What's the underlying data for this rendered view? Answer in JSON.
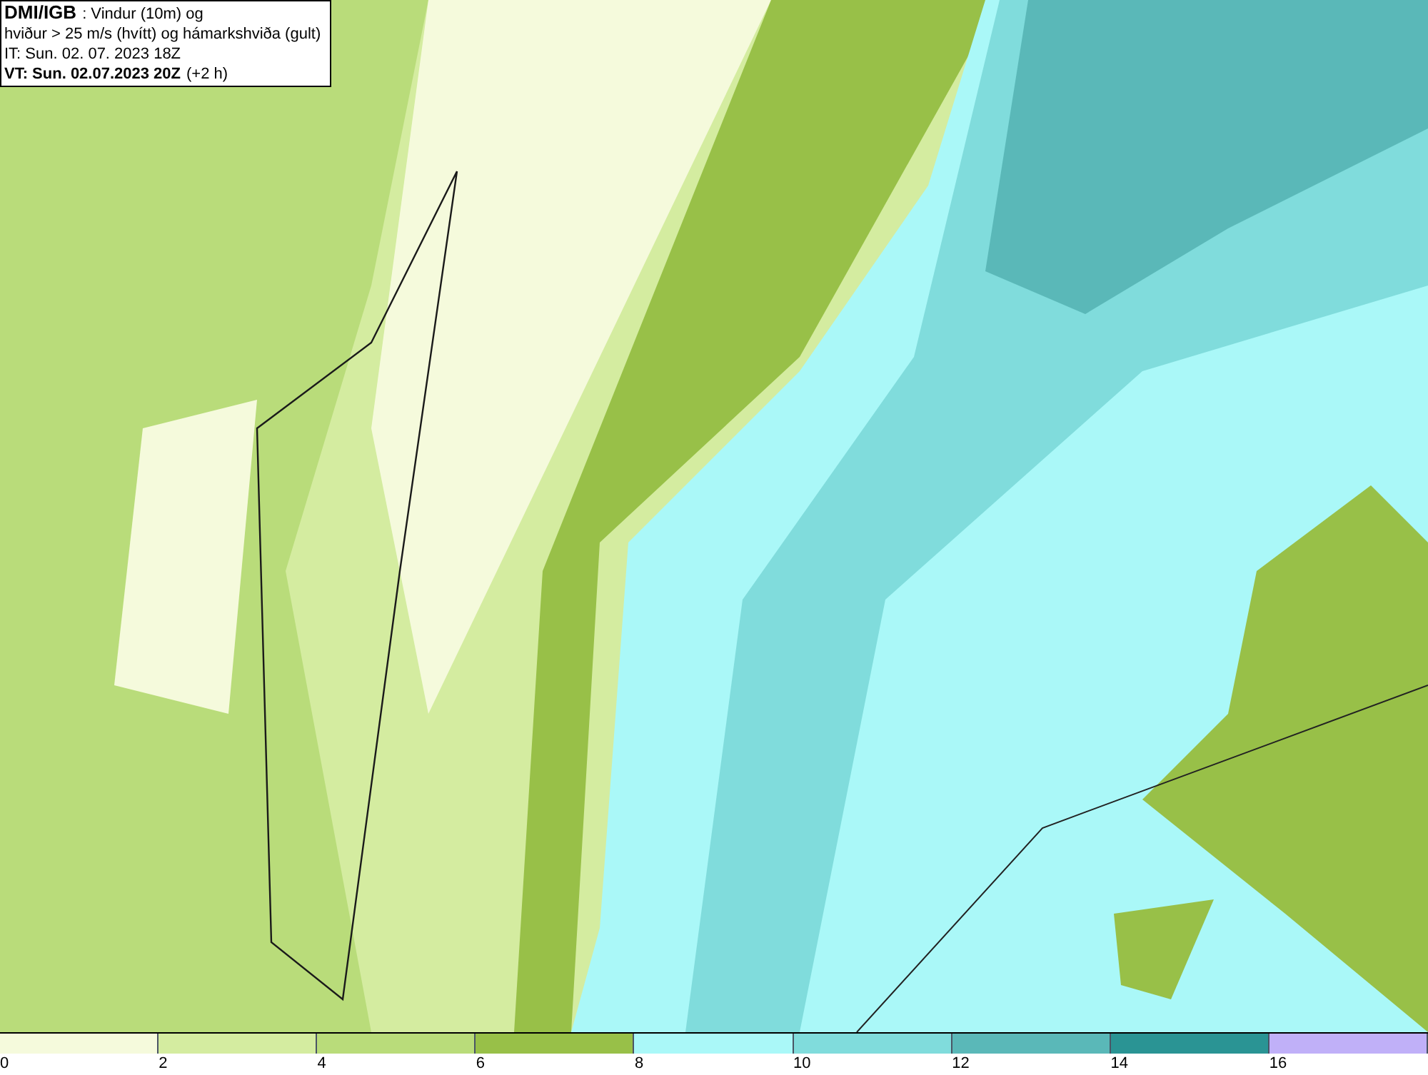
{
  "title_box": {
    "source": "DMI/IGB",
    "line_1": ": Vindur (10m) og",
    "line_2": "hviður > 25 m/s (hvítt) og hámarkshviða (gult)",
    "issue_time": "IT: Sun. 02. 07. 2023 18Z",
    "valid_time": "VT: Sun. 02.07.2023 20Z",
    "valid_offset": "(+2 h)"
  },
  "legend": [
    {
      "label": "0",
      "color": "#f5fadc"
    },
    {
      "label": "2",
      "color": "#d4eca0"
    },
    {
      "label": "4",
      "color": "#b9dc7a"
    },
    {
      "label": "6",
      "color": "#98c048"
    },
    {
      "label": "8",
      "color": "#aaf8f8"
    },
    {
      "label": "10",
      "color": "#80dcdc"
    },
    {
      "label": "12",
      "color": "#5ab8b8"
    },
    {
      "label": "14",
      "color": "#2a9494"
    },
    {
      "label": "16",
      "color": "#c0b0f8"
    }
  ]
}
